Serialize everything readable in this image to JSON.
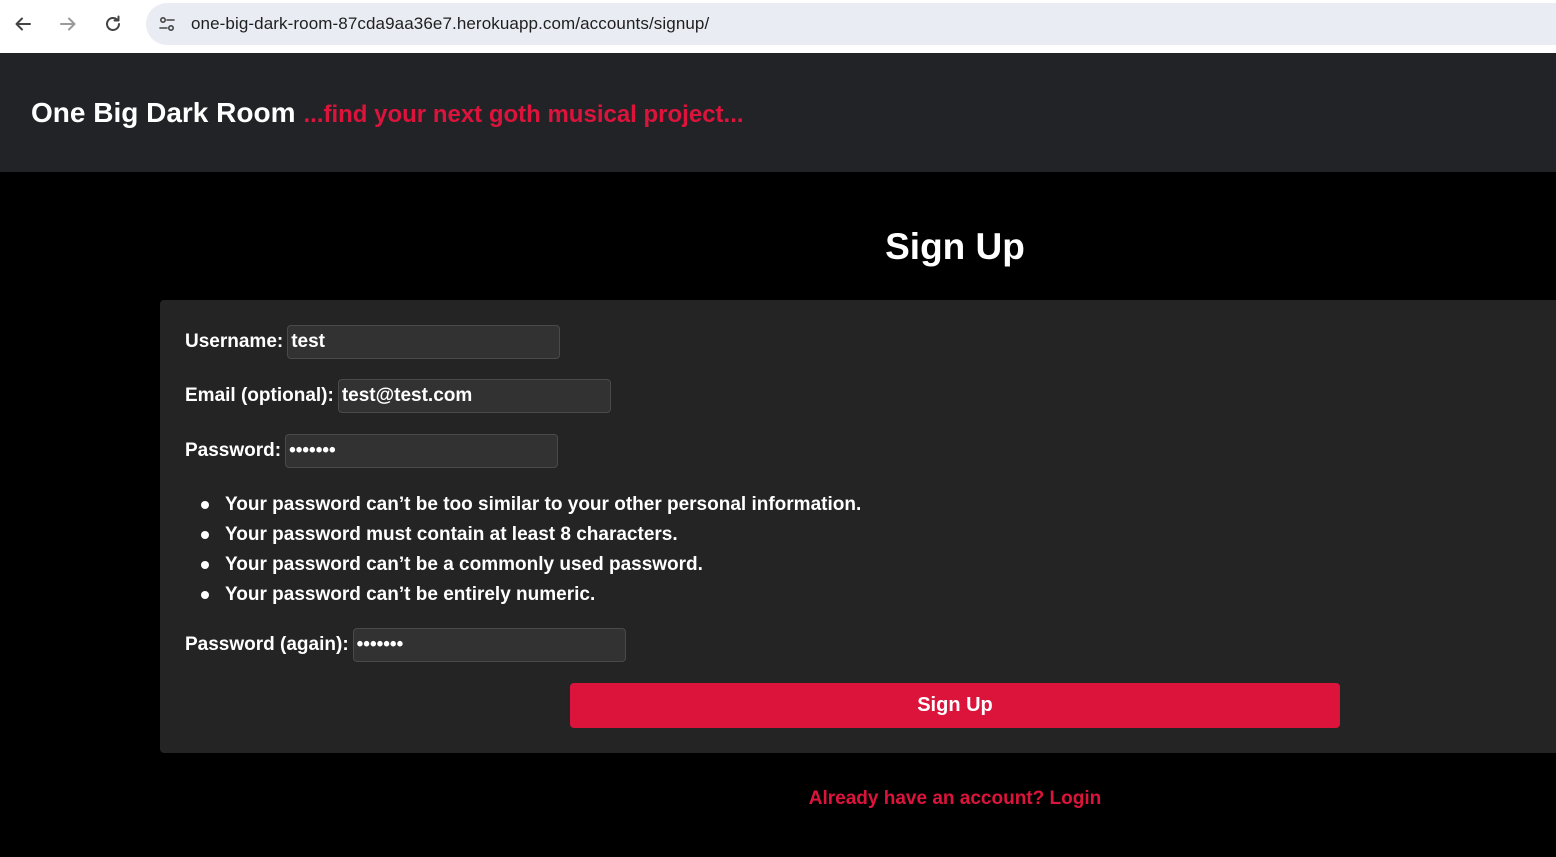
{
  "browser": {
    "url": "one-big-dark-room-87cda9aa36e7.herokuapp.com/accounts/signup/",
    "back_icon": "arrow-left-icon",
    "forward_icon": "arrow-right-icon",
    "reload_icon": "reload-icon",
    "site_info_icon": "tune-icon"
  },
  "header": {
    "brand_name": "One Big Dark Room",
    "tagline": "...find your next goth musical project...",
    "tagline_color": "#dc143c",
    "background": "#212327"
  },
  "main": {
    "title": "Sign Up",
    "form": {
      "username": {
        "label": "Username:",
        "value": "test"
      },
      "email": {
        "label": "Email (optional):",
        "value": "test@test.com"
      },
      "password": {
        "label": "Password:",
        "value": "•••••••"
      },
      "password_help": [
        "Your password can’t be too similar to your other personal information.",
        "Your password must contain at least 8 characters.",
        "Your password can’t be a commonly used password.",
        "Your password can’t be entirely numeric."
      ],
      "password_again": {
        "label": "Password (again):",
        "value": "•••••••"
      },
      "submit_label": "Sign Up",
      "accent_color": "#dc143c"
    },
    "login_link": "Already have an account? Login"
  }
}
